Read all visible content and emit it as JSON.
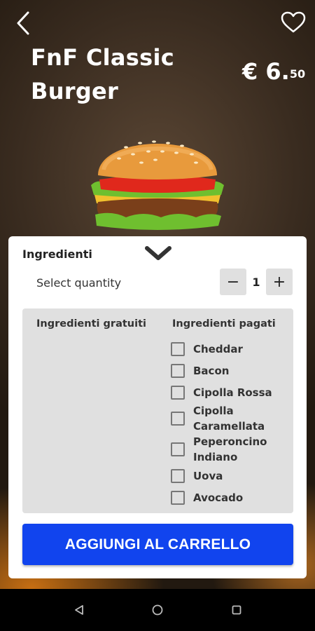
{
  "product": {
    "title": "FnF Classic Burger",
    "price_main": "€ 6.",
    "price_cents": "50"
  },
  "sheet": {
    "title": "Ingredienti",
    "quantity_label": "Select quantity",
    "quantity_value": "1",
    "minus_label": "−",
    "plus_label": "+",
    "free_ingredients_title": "Ingredienti gratuiti",
    "paid_ingredients_title": "Ingredienti pagati",
    "paid_ingredients": [
      {
        "label": "Cheddar",
        "checked": false
      },
      {
        "label": "Bacon",
        "checked": false
      },
      {
        "label": "Cipolla Rossa",
        "checked": false
      },
      {
        "label": "Cipolla Caramellata",
        "checked": false
      },
      {
        "label": "Peperoncino Indiano",
        "checked": false
      },
      {
        "label": "Uova",
        "checked": false
      },
      {
        "label": "Avocado",
        "checked": false
      }
    ],
    "add_to_cart_label": "AGGIUNGI AL CARRELLO"
  },
  "icons": {
    "back": "back-arrow-icon",
    "favorite": "heart-icon",
    "collapse": "chevron-down-icon",
    "nav_back": "nav-back-icon",
    "nav_home": "nav-home-icon",
    "nav_recents": "nav-recents-icon"
  },
  "colors": {
    "accent": "#1144ee",
    "panel": "#e0e0e0",
    "sheet": "#ffffff"
  }
}
